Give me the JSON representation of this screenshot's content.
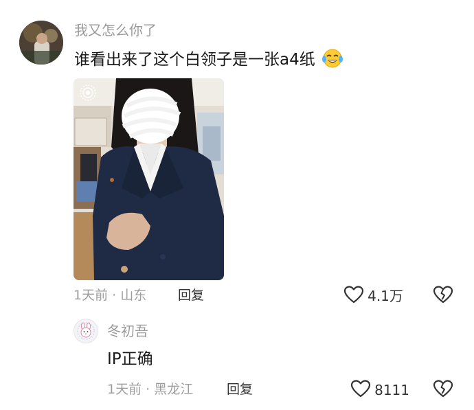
{
  "comment": {
    "username": "我又怎么你了",
    "text": "谁看出来了这个白领子是一张a4纸",
    "emoji": "crying-laughing-emoji",
    "time": "1天前",
    "location": "山东",
    "reply_label": "回复",
    "likes": "4.1万"
  },
  "reply": {
    "username": "冬初吾",
    "text": "IP正确",
    "time": "1天前",
    "location": "黑龙江",
    "reply_label": "回复",
    "likes": "8111"
  },
  "icons": {
    "like": "heart-outline-icon",
    "dislike": "broken-heart-icon",
    "photo_badge": "live-photo-icon"
  },
  "colors": {
    "meta_gray": "#9e9e9e",
    "text_dark": "#1a1a1a",
    "blazer_navy": "#1f2a44"
  }
}
